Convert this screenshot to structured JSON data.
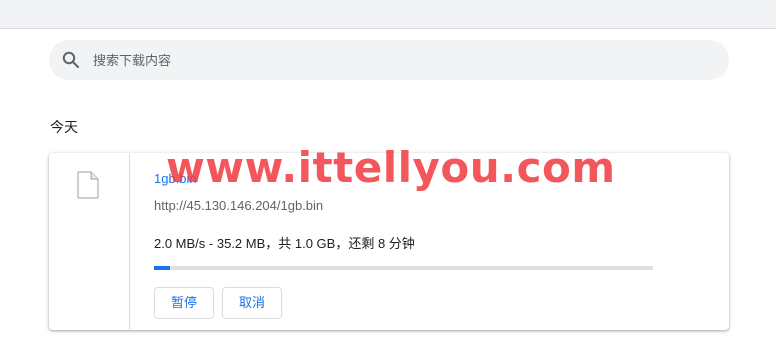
{
  "search": {
    "placeholder": "搜索下载内容",
    "value": ""
  },
  "section": {
    "date_label": "今天"
  },
  "download": {
    "file_name": "1gb.bin",
    "url": "http://45.130.146.204/1gb.bin",
    "status": "2.0 MB/s - 35.2 MB，共 1.0 GB，还剩 8 分钟",
    "progress_fraction": 0.032,
    "pause_label": "暂停",
    "cancel_label": "取消"
  },
  "watermark": {
    "text": "www.ittellyou.com"
  },
  "colors": {
    "accent": "#1a73e8",
    "watermark": "#f23a3e",
    "search_bg": "#f1f3f4"
  },
  "icons": {
    "search": "search-icon",
    "file": "file-icon"
  }
}
